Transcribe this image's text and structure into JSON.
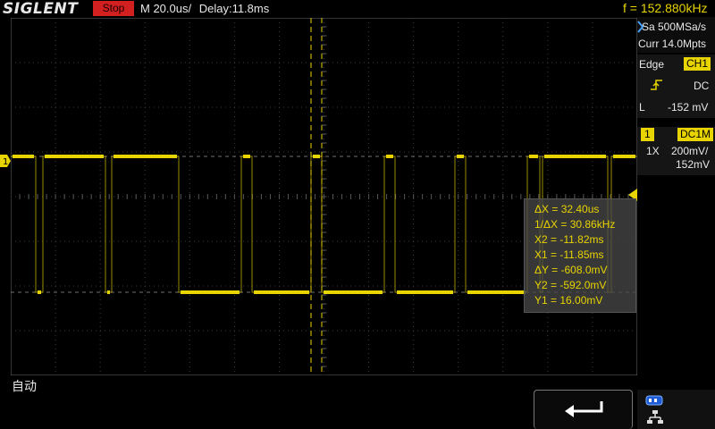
{
  "header": {
    "brand": "SIGLENT",
    "run_state": "Stop",
    "timebase": "M 20.0us/",
    "delay": "Delay:11.8ms",
    "trigger_frequency": "f = 152.880kHz"
  },
  "acquisition": {
    "sample_rate": "Sa 500MSa/s",
    "memory_depth": "Curr 14.0Mpts"
  },
  "trigger": {
    "type": "Edge",
    "source": "CH1",
    "coupling": "DC",
    "level_label": "L",
    "level": "-152 mV"
  },
  "channel1": {
    "number": "1",
    "coupling": "DC1M",
    "probe": "1X",
    "scale": "200mV/",
    "offset": "152mV",
    "marker": "1"
  },
  "cursors": {
    "dx": "ΔX = 32.40us",
    "inv_dx": "1/ΔX = 30.86kHz",
    "x2": "X2 = -11.82ms",
    "x1": "X1 = -11.85ms",
    "dy": "ΔY = -608.0mV",
    "y2": "Y2 = -592.0mV",
    "y1": "Y1 = 16.00mV"
  },
  "footer": {
    "mode": "自动"
  },
  "colors": {
    "trace": "#e8d400",
    "stop": "#d21f1f",
    "grid": "#3c3c3c"
  },
  "icons": {
    "back": "return-arrow-icon",
    "usb": "usb-icon",
    "network": "network-icon"
  }
}
